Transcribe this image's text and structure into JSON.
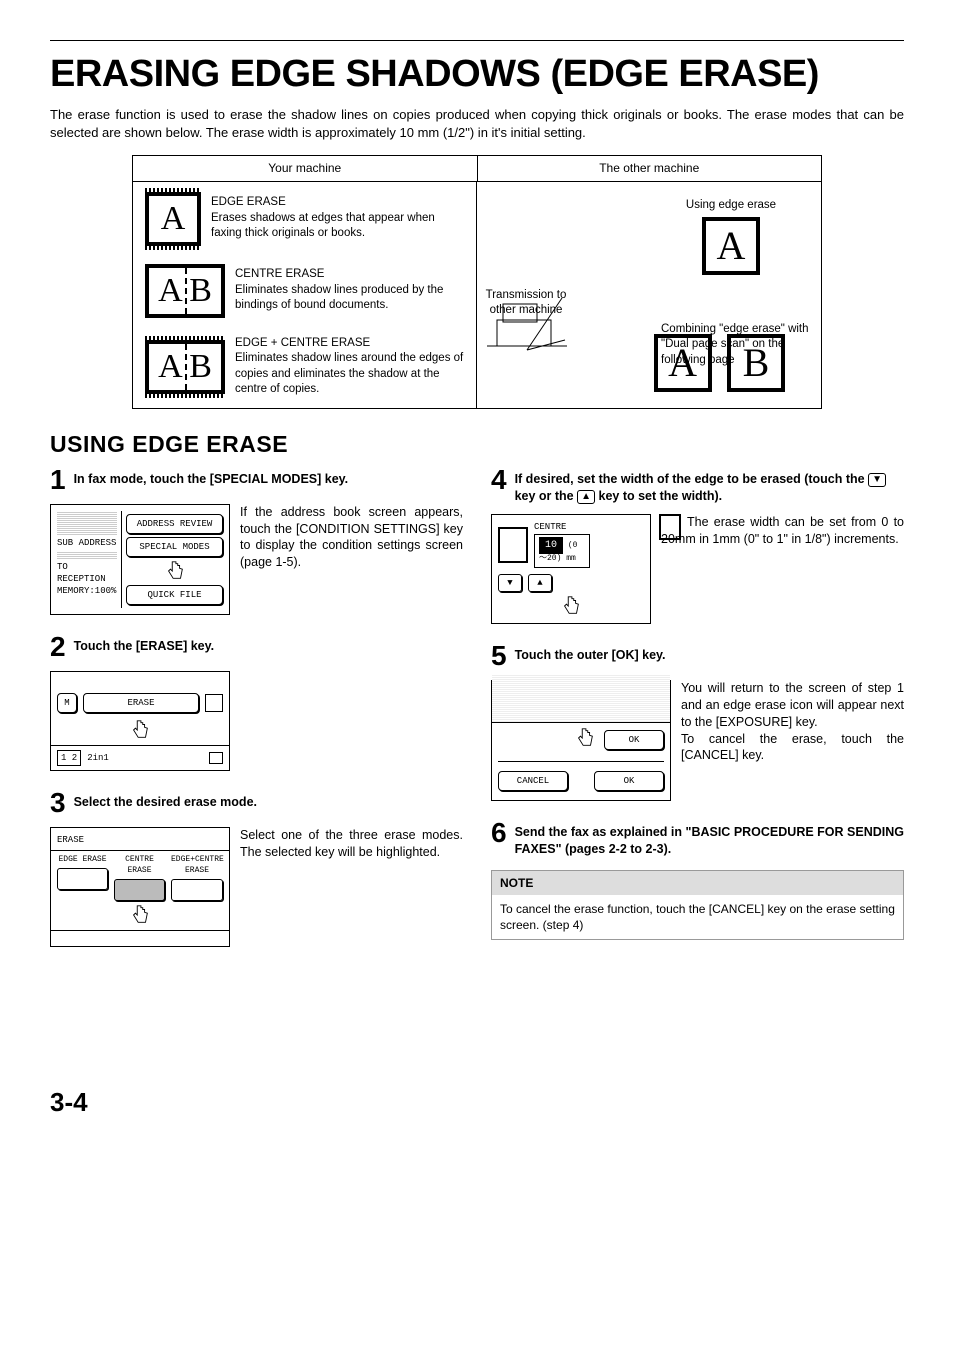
{
  "title": "ERASING EDGE SHADOWS (EDGE ERASE)",
  "intro": "The erase function is used to erase the shadow lines on copies produced when copying thick originals or books. The erase modes that can be selected are shown below. The erase width is approximately 10 mm (1/2\") in it's initial setting.",
  "diagram": {
    "left_head": "Your machine",
    "right_head": "The other machine",
    "rows": [
      {
        "letters": "A",
        "name": "EDGE ERASE",
        "desc": "Erases shadows at edges that appear when faxing thick originals or books."
      },
      {
        "letters": "A B",
        "name": "CENTRE ERASE",
        "desc": "Eliminates shadow lines produced by the bindings of bound documents."
      },
      {
        "letters": "A B",
        "name": "EDGE + CENTRE ERASE",
        "desc": "Eliminates shadow lines around the edges of copies and eliminates the shadow at the centre of copies."
      }
    ],
    "trans": "Transmission to other machine",
    "using": "Using edge erase",
    "combo": "Combining \"edge erase\" with \"Dual page scan\" on the following page"
  },
  "section": "USING EDGE ERASE",
  "steps_left": [
    {
      "num": "1",
      "head": "In fax mode, touch the [SPECIAL MODES] key.",
      "caption": "If the address book screen appears, touch the [CONDITION SETTINGS] key to display the condition settings screen (page 1-5).",
      "screen": {
        "top_btns": [
          "ADDRESS REVIEW",
          "SPECIAL MODES"
        ],
        "left_items": [
          "SUB ADDRESS",
          "TO RECEPTION",
          "MEMORY:100%"
        ],
        "bottom_btn": "QUICK FILE"
      }
    },
    {
      "num": "2",
      "head": "Touch the [ERASE] key.",
      "screen2": {
        "m": "M",
        "erase": "ERASE",
        "twoin1": "2in1",
        "pg": "1 2"
      }
    },
    {
      "num": "3",
      "head": "Select the desired erase mode.",
      "caption": "Select one of the three erase modes. The selected key will be highlighted.",
      "screen3": {
        "title": "ERASE",
        "opts": [
          "EDGE ERASE",
          "CENTRE ERASE",
          "EDGE+CENTRE ERASE"
        ]
      }
    }
  ],
  "steps_right": [
    {
      "num": "4",
      "head_parts": [
        "If desired, set the width of the edge to be erased (touch the ",
        " key or the ",
        " key to set the width)."
      ],
      "key_down": "▼",
      "key_up": "▲",
      "caption": "The erase width can be set from 0 to 20mm in 1mm (0\" to 1\" in 1/8\") increments.",
      "screen4": {
        "label": "CENTRE",
        "value": "10",
        "range": "(0～20)",
        "unit": "mm"
      }
    },
    {
      "num": "5",
      "head": "Touch the outer [OK] key.",
      "caption": "You will return to the screen of step 1 and an edge erase icon will appear next to the [EXPOSURE] key.\nTo cancel the erase, touch the [CANCEL] key.",
      "screen5": {
        "ok": "OK",
        "cancel": "CANCEL"
      }
    },
    {
      "num": "6",
      "head": "Send the fax as explained in \"BASIC PROCEDURE FOR SENDING FAXES\" (pages 2-2 to 2-3)."
    }
  ],
  "note": {
    "head": "NOTE",
    "body": "To cancel the erase function, touch the [CANCEL] key on the erase setting screen. (step 4)"
  },
  "pagenum": "3-4"
}
